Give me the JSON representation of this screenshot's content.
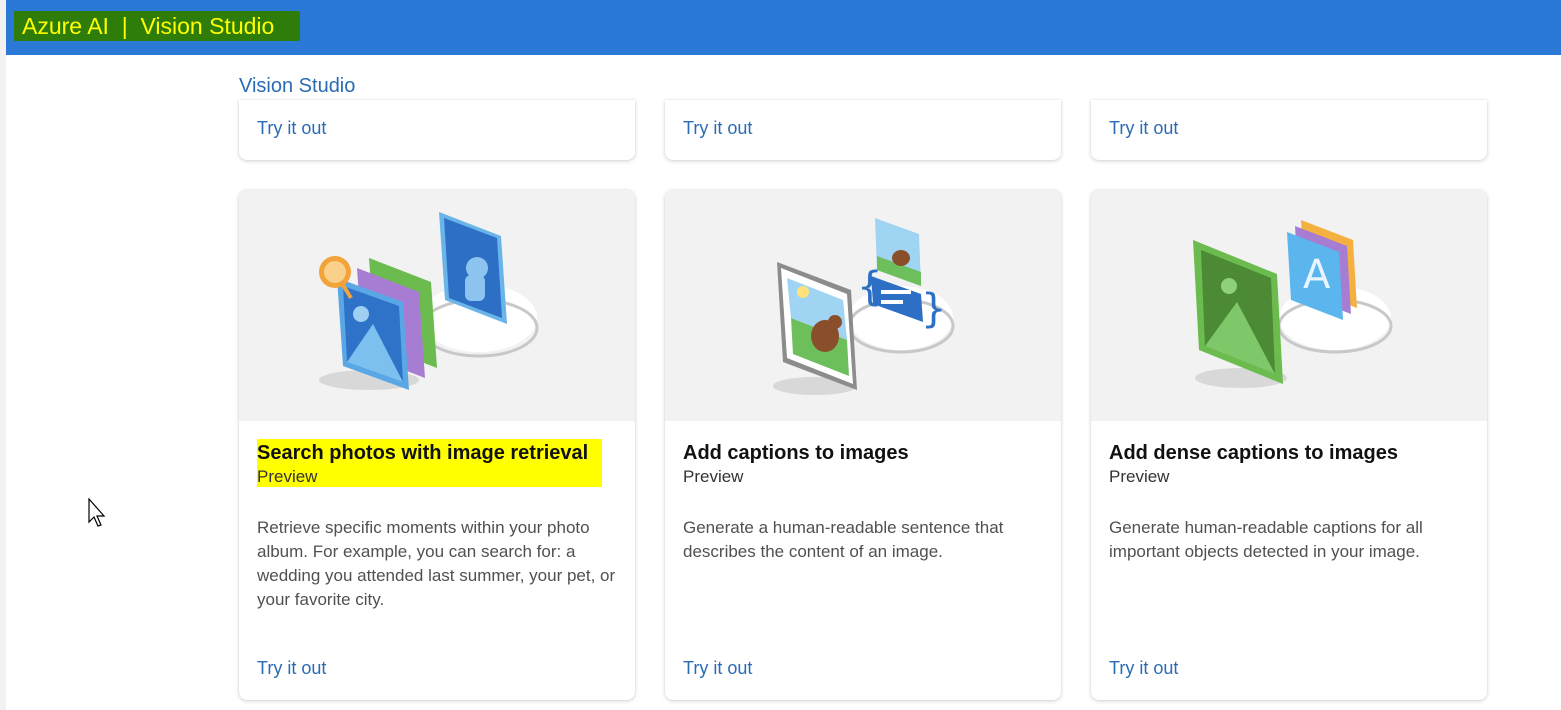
{
  "header": {
    "brand": "Azure AI  |  Vision Studio"
  },
  "breadcrumb": {
    "label": "Vision Studio"
  },
  "top_cards": [
    {
      "action": "Try it out"
    },
    {
      "action": "Try it out"
    },
    {
      "action": "Try it out"
    }
  ],
  "cards": [
    {
      "title": "Search photos with image retrieval",
      "tag": "Preview",
      "description": "Retrieve specific moments within your photo album. For example, you can search for: a wedding you attended last summer, your pet, or your favorite city.",
      "action": "Try it out"
    },
    {
      "title": "Add captions to images",
      "tag": "Preview",
      "description": "Generate a human-readable sentence that describes the content of an image.",
      "action": "Try it out"
    },
    {
      "title": "Add dense captions to images",
      "tag": "Preview",
      "description": "Generate human-readable captions for all important objects detected in your image.",
      "action": "Try it out"
    }
  ],
  "colors": {
    "topbar": "#2b79d6",
    "brand_bg": "#2e7d0a",
    "brand_text": "#ffff00",
    "link": "#2a6bb5",
    "highlight": "#ffff00"
  }
}
